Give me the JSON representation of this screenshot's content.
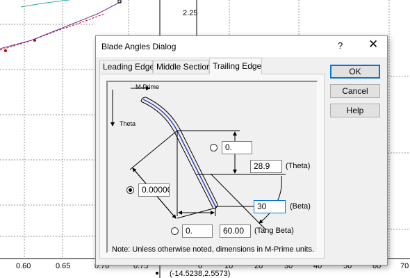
{
  "background": {
    "x_axis_ticks": [
      "0.60",
      "0.65",
      "0.70",
      "0.75"
    ],
    "y_tick_label": "2.25",
    "right_axis_ticks": [
      "0",
      "10",
      "20",
      "30",
      "40",
      "50",
      "60",
      "70"
    ],
    "status_coords": "(-14.5238,2.5573)",
    "curve_colors": {
      "teal": "#2aa6a0",
      "red": "#c00000",
      "purple": "#7030a0"
    }
  },
  "dialog": {
    "title": "Blade Angles Dialog",
    "help_label": "?",
    "close_label": "✕",
    "tabs": [
      {
        "label": "Leading Edge",
        "active": false
      },
      {
        "label": "Middle Section",
        "active": false
      },
      {
        "label": "Trailing Edge",
        "active": true
      }
    ],
    "buttons": {
      "ok": "OK",
      "cancel": "Cancel",
      "help": "Help"
    },
    "diagram": {
      "mprime_label": "M-Prime",
      "theta_axis_label": "Theta",
      "fields": {
        "top_value": "0.",
        "theta_value": "28.9",
        "left_value": "0.00000",
        "beta_value": "30",
        "bottom_value": "0.",
        "tang_beta_value": "60.00"
      },
      "labels": {
        "theta": "(Theta)",
        "beta": "(Beta)",
        "tang_beta": "(Tang Beta)"
      },
      "radios": {
        "top": false,
        "left": true,
        "bottom": false
      },
      "note": "Note: Unless otherwise noted, dimensions in M-Prime units."
    }
  }
}
